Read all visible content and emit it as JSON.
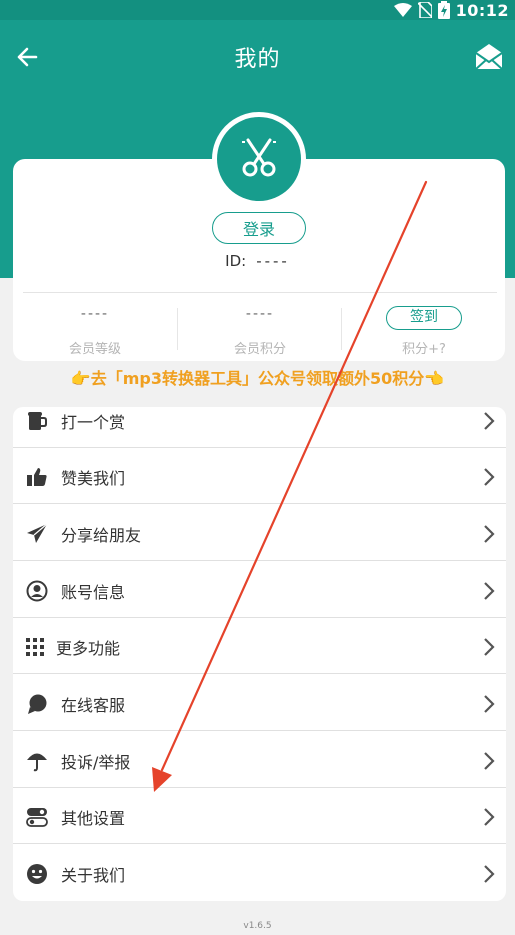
{
  "statusbar": {
    "time": "10:12"
  },
  "appbar": {
    "title": "我的",
    "back_icon": "arrow-left-icon",
    "mail_icon": "mail-icon"
  },
  "profile": {
    "logo_icon": "scissors-icon",
    "login_label": "登录",
    "id_label": "ID:",
    "id_value": "----",
    "stats": [
      {
        "value": "----",
        "label": "会员等级"
      },
      {
        "value": "----",
        "label": "会员积分"
      },
      {
        "button": "签到",
        "label": "积分+?"
      }
    ]
  },
  "promo": {
    "text": "👉去「mp3转换器工具」公众号领取额外50积分👈"
  },
  "menu": {
    "items": [
      {
        "label": "打一个赏",
        "icon": "beer-mug-icon"
      },
      {
        "label": "赞美我们",
        "icon": "thumbs-up-icon"
      },
      {
        "label": "分享给朋友",
        "icon": "paper-plane-icon"
      },
      {
        "label": "账号信息",
        "icon": "user-circle-icon"
      },
      {
        "label": "更多功能",
        "icon": "grid-icon"
      },
      {
        "label": "在线客服",
        "icon": "chat-bubble-icon"
      },
      {
        "label": "投诉/举报",
        "icon": "umbrella-icon"
      },
      {
        "label": "其他设置",
        "icon": "toggle-icon"
      },
      {
        "label": "关于我们",
        "icon": "smiley-icon"
      }
    ]
  },
  "footer": {
    "version": "v1.6.5"
  },
  "colors": {
    "primary": "#179d8d",
    "accent": "#f0a020",
    "annotation": "#e5432b"
  }
}
